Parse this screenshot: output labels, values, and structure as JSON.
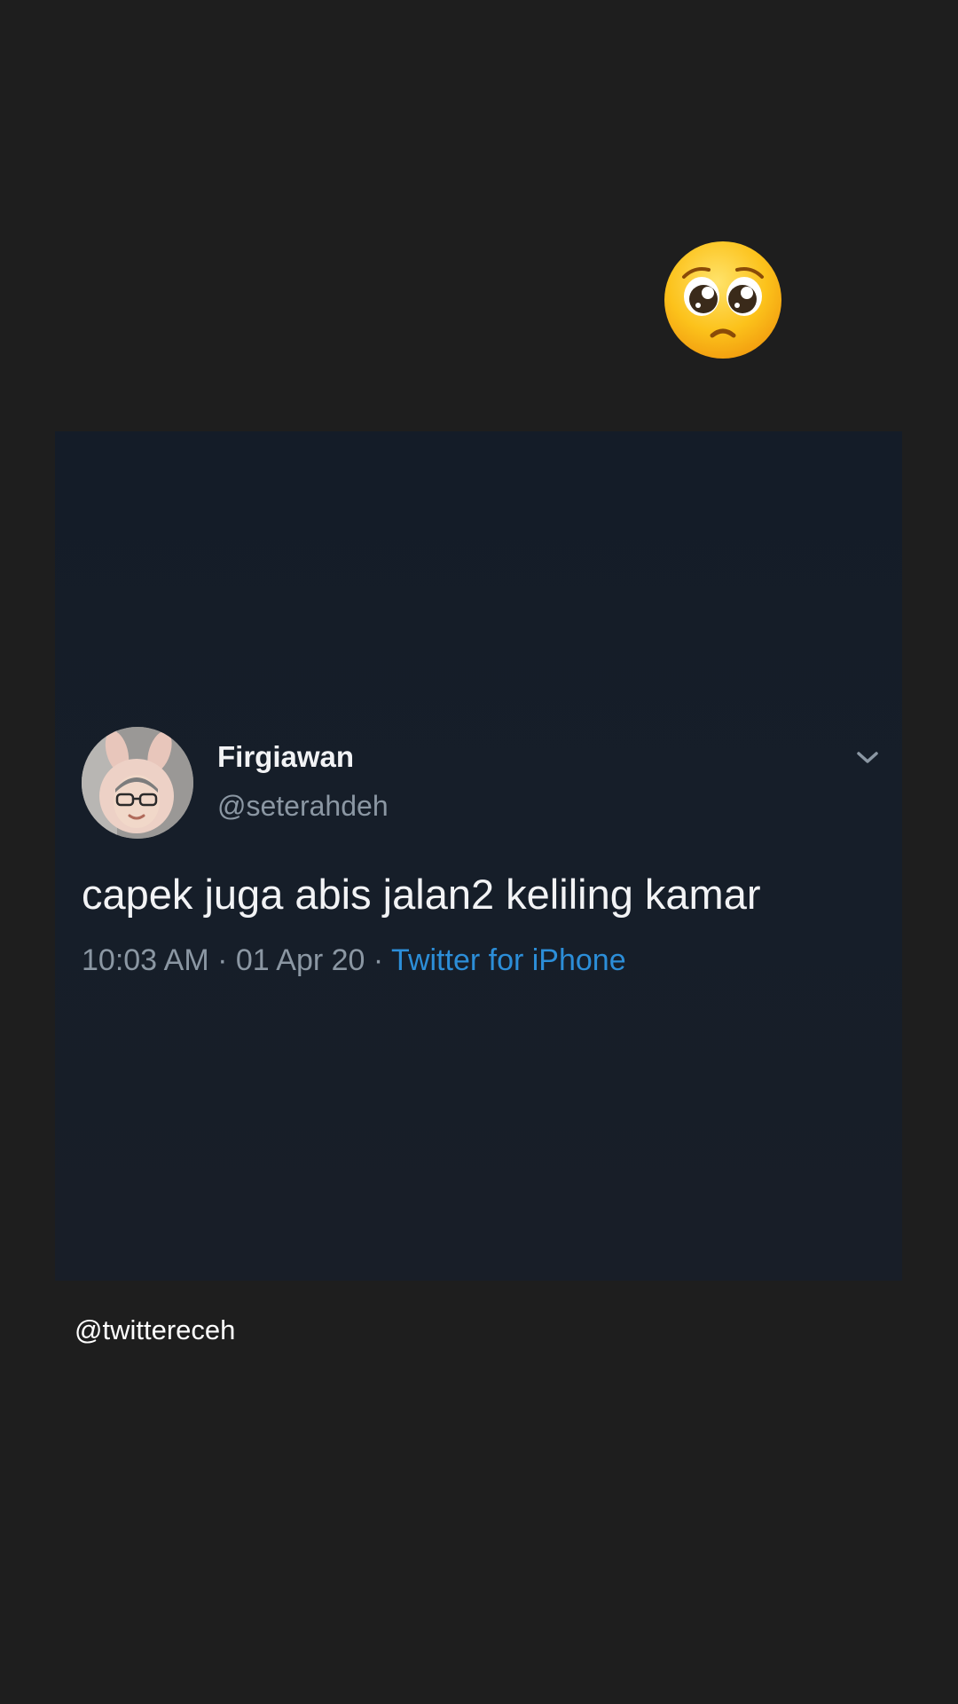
{
  "sticker": {
    "icon": "pleading-face-emoji"
  },
  "tweet": {
    "author": {
      "name": "Firgiawan",
      "handle": "@seterahdeh"
    },
    "text": "capek juga abis jalan2 keliling kamar",
    "time": "10:03 AM",
    "date": "01 Apr 20",
    "separator": " · ",
    "source": "Twitter for iPhone",
    "menu_icon": "chevron-down-icon"
  },
  "watermark": "@twittereceh",
  "colors": {
    "background": "#1e1e1e",
    "card": "#161e29",
    "text_primary": "#f2f3f5",
    "text_secondary": "#8b97a3",
    "link": "#2c8ed8"
  }
}
